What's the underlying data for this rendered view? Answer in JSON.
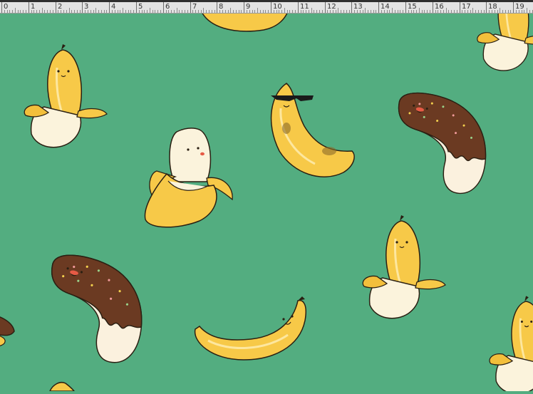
{
  "ruler": {
    "unit_labels": [
      "0",
      "1",
      "2",
      "3",
      "4",
      "5",
      "6",
      "7",
      "8",
      "9",
      "10",
      "11",
      "12",
      "13",
      "14",
      "15",
      "16",
      "17",
      "18",
      "19"
    ]
  },
  "canvas": {
    "background_color": "#53ad80",
    "pattern_items": [
      {
        "kind": "peeled-banana",
        "face": "smiling"
      },
      {
        "kind": "chocolate-dipped-banana",
        "face": "smiling"
      },
      {
        "kind": "banana-with-sunglasses",
        "face": "cool"
      },
      {
        "kind": "half-peeled-banana",
        "face": "surprised"
      },
      {
        "kind": "whole-banana",
        "face": "smiling"
      }
    ]
  }
}
